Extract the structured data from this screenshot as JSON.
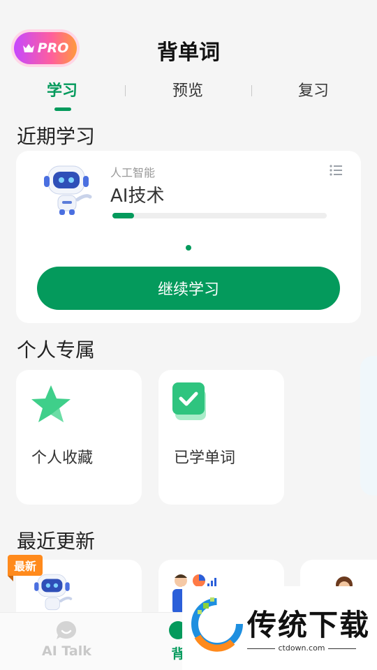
{
  "header": {
    "pro_label": "PRO",
    "title": "背单词"
  },
  "tabs": [
    {
      "label": "学习",
      "active": true
    },
    {
      "label": "预览",
      "active": false
    },
    {
      "label": "复习",
      "active": false
    }
  ],
  "recent": {
    "section_title": "近期学习",
    "category": "人工智能",
    "name": "AI技术",
    "progress": 0.1,
    "continue_label": "继续学习"
  },
  "personal": {
    "section_title": "个人专属",
    "items": [
      {
        "label": "个人收藏",
        "icon": "star-icon"
      },
      {
        "label": "已学单词",
        "icon": "check-icon"
      }
    ]
  },
  "updates": {
    "section_title": "最近更新",
    "new_badge": "最新"
  },
  "bottom_nav": {
    "items": [
      {
        "label": "AI Talk",
        "icon": "chat-bubble-icon",
        "active": false
      },
      {
        "label": "背",
        "icon": "book-icon",
        "active": true
      }
    ]
  },
  "watermark": {
    "text": "传统下载",
    "url": "ctdown.com"
  },
  "colors": {
    "accent": "#049a5c",
    "background": "#f5f5f5",
    "badge": "#ff8a1c"
  }
}
